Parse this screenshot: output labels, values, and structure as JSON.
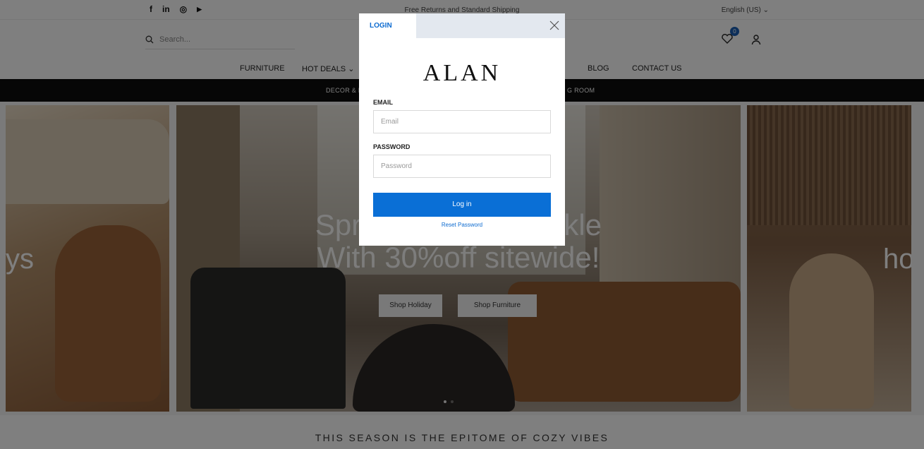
{
  "topbar": {
    "social": [
      {
        "name": "facebook-icon",
        "glyph": "f"
      },
      {
        "name": "linkedin-icon",
        "glyph": "in"
      },
      {
        "name": "instagram-icon",
        "glyph": "◎"
      },
      {
        "name": "youtube-icon",
        "glyph": "▶"
      }
    ],
    "promo": "Free Returns and Standard Shipping",
    "language": "English (US) ⌄"
  },
  "header": {
    "search_placeholder": "Search...",
    "wishlist_count": "0"
  },
  "nav": {
    "items": [
      "FURNITURE",
      "HOT DEALS ⌄",
      "BLOG",
      "CONTACT US"
    ]
  },
  "subnav": {
    "items": [
      "DECOR & M",
      "G ROOM"
    ]
  },
  "hero": {
    "headline_line1": "Spread Joy & Sparkle",
    "headline_line2": "With 30%off sitewide!",
    "button_holiday": "Shop Holiday",
    "button_furniture": "Shop Furniture",
    "left_peek_text": "ys",
    "right_peek_text": "ho"
  },
  "tagline": "THIS SEASON IS THE EPITOME OF COZY VIBES",
  "modal": {
    "tab_label": "LOGIN",
    "logo": "ALAN",
    "email_label": "EMAIL",
    "email_placeholder": "Email",
    "password_label": "PASSWORD",
    "password_placeholder": "Password",
    "submit_label": "Log in",
    "reset_label": "Reset Password"
  },
  "colors": {
    "accent": "#0a6fd6",
    "badge": "#1a5fb4",
    "subnav_bg": "#0c0c0c"
  }
}
